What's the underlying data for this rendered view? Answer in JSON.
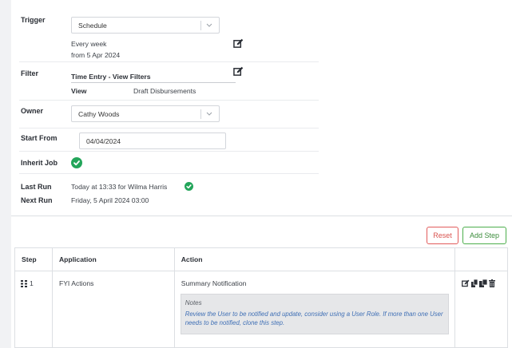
{
  "form": {
    "trigger": {
      "label": "Trigger",
      "selected": "Schedule",
      "schedule_line1": "Every week",
      "schedule_line2": "from 5 Apr 2024"
    },
    "filter": {
      "label": "Filter",
      "name": "Time Entry - View Filters",
      "view_label": "View",
      "view_value": "Draft Disbursements"
    },
    "owner": {
      "label": "Owner",
      "selected": "Cathy Woods"
    },
    "start_from": {
      "label": "Start From",
      "value": "04/04/2024"
    },
    "inherit_job": {
      "label": "Inherit Job",
      "checked": true
    },
    "last_run": {
      "label": "Last Run",
      "value": "Today at 13:33 for Wilma Harris"
    },
    "next_run": {
      "label": "Next Run",
      "value": "Friday, 5 April 2024 03:00"
    }
  },
  "buttons": {
    "reset": "Reset",
    "add_step": "Add Step"
  },
  "steps_table": {
    "headers": {
      "step": "Step",
      "application": "Application",
      "action": "Action"
    },
    "rows": [
      {
        "step": "1",
        "application": "FYI Actions",
        "action": "Summary Notification",
        "notes_title": "Notes",
        "notes_body": "Review the User to be notified and update, consider using a User Role. If more than one User needs to be notified, clone this step."
      }
    ]
  },
  "colors": {
    "success": "#23a55a",
    "danger": "#d9534f",
    "link": "#3f6fb5"
  },
  "icons": [
    "edit-icon",
    "chevron-down-icon",
    "check-icon",
    "grip-icon",
    "copy-icon",
    "clone-icon",
    "trash-icon"
  ]
}
